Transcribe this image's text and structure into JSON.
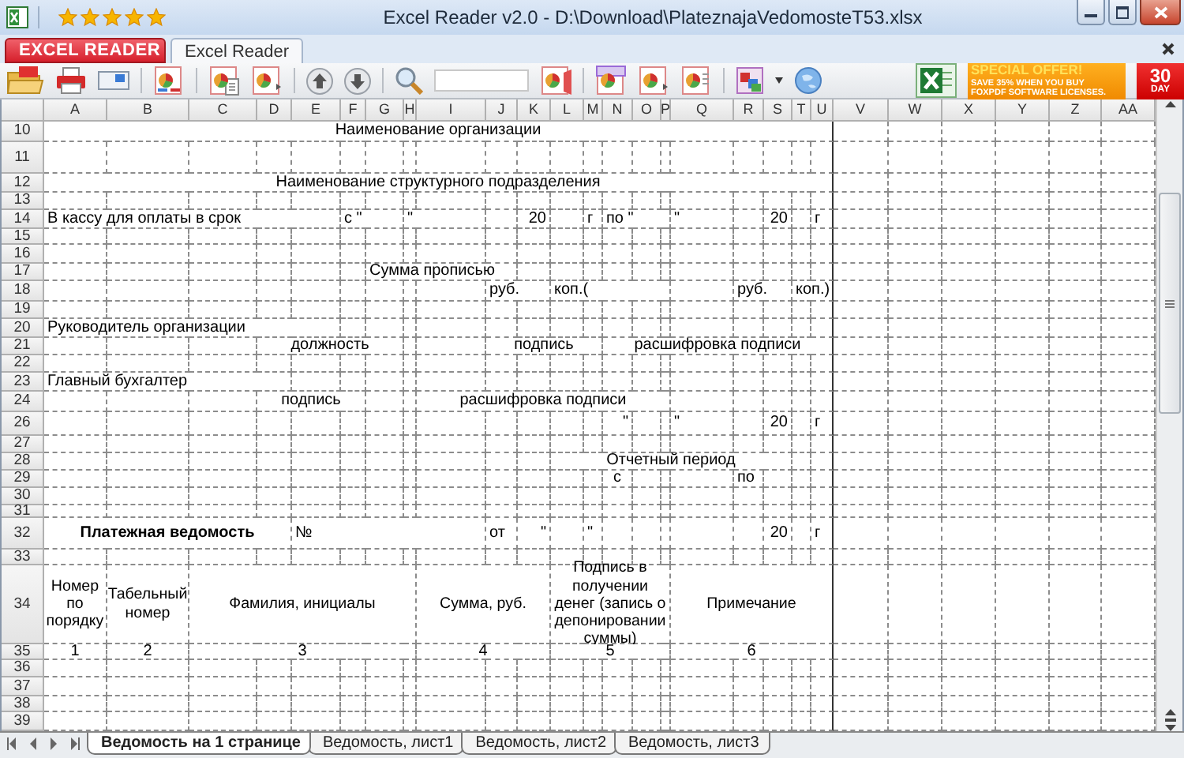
{
  "window": {
    "title": "Excel Reader v2.0 - D:\\Download\\PlateznajaVedomosteT53.xlsx",
    "rating": {
      "stars": 5
    }
  },
  "app_button": {
    "label": "EXCEL READER"
  },
  "ribbon_tabs": [
    {
      "label": "Excel Reader",
      "selected": true
    }
  ],
  "promo": {
    "headline": "SPECIAL OFFER!",
    "lines": [
      "SAVE 35% WHEN YOU BUY",
      "FOXPDF SOFTWARE LICENSES."
    ],
    "badge": [
      "30",
      "DAY"
    ]
  },
  "sheet": {
    "columns": [
      "A",
      "B",
      "C",
      "D",
      "E",
      "F",
      "G",
      "H",
      "I",
      "J",
      "K",
      "L",
      "M",
      "N",
      "O",
      "P",
      "Q",
      "R",
      "S",
      "T",
      "U",
      "V",
      "W",
      "X",
      "Y",
      "Z",
      "AA"
    ],
    "rows": [
      {
        "number": "10",
        "cells": [
          "Наименование организации"
        ]
      },
      {
        "number": "11"
      },
      {
        "number": "12",
        "cells": [
          "Наименование структурного подразделения"
        ]
      },
      {
        "number": "13"
      },
      {
        "number": "14",
        "cells": [
          "В кассу для оплаты в срок",
          "с \"",
          "\"",
          "20",
          "г",
          "по \"",
          "\"",
          "20",
          "г"
        ]
      },
      {
        "number": "15"
      },
      {
        "number": "16"
      },
      {
        "number": "17",
        "cells": [
          "Сумма прописью"
        ]
      },
      {
        "number": "18",
        "cells": [
          "руб.",
          "коп.(",
          "руб.",
          "коп.)"
        ]
      },
      {
        "number": "19"
      },
      {
        "number": "20",
        "cells": [
          "Руководитель организации"
        ]
      },
      {
        "number": "21",
        "cells": [
          "должность",
          "подпись",
          "расшифровка подписи"
        ]
      },
      {
        "number": "22"
      },
      {
        "number": "23",
        "cells": [
          "Главный бухгалтер"
        ]
      },
      {
        "number": "24",
        "cells": [
          "подпись",
          "расшифровка подписи"
        ]
      },
      {
        "number": "26",
        "cells": [
          "\"",
          "\"",
          "20",
          "г"
        ]
      },
      {
        "number": "27"
      },
      {
        "number": "28",
        "cells": [
          "Отчетный период"
        ]
      },
      {
        "number": "29",
        "cells": [
          "с",
          "по"
        ]
      },
      {
        "number": "30"
      },
      {
        "number": "31"
      },
      {
        "number": "32",
        "cells": [
          "Платежная ведомость",
          "№",
          "от",
          "\"",
          "\"",
          "20",
          "г"
        ]
      },
      {
        "number": "33"
      },
      {
        "number": "34",
        "cells": [
          "Номер по порядку",
          "Табельный номер",
          "Фамилия, инициалы",
          "Сумма, руб.",
          "Подпись в получении денег (запись о депонировании суммы)",
          "Примечание"
        ]
      },
      {
        "number": "35",
        "cells": [
          "1",
          "2",
          "3",
          "4",
          "5",
          "6"
        ]
      },
      {
        "number": "36"
      },
      {
        "number": "37"
      },
      {
        "number": "38"
      },
      {
        "number": "39"
      }
    ]
  },
  "sheet_tabs": [
    {
      "label": "Ведомость на 1 странице",
      "selected": true
    },
    {
      "label": "Ведомость, лист1",
      "selected": false
    },
    {
      "label": "Ведомость, лист2",
      "selected": false
    },
    {
      "label": "Ведомость, лист3",
      "selected": false
    }
  ]
}
